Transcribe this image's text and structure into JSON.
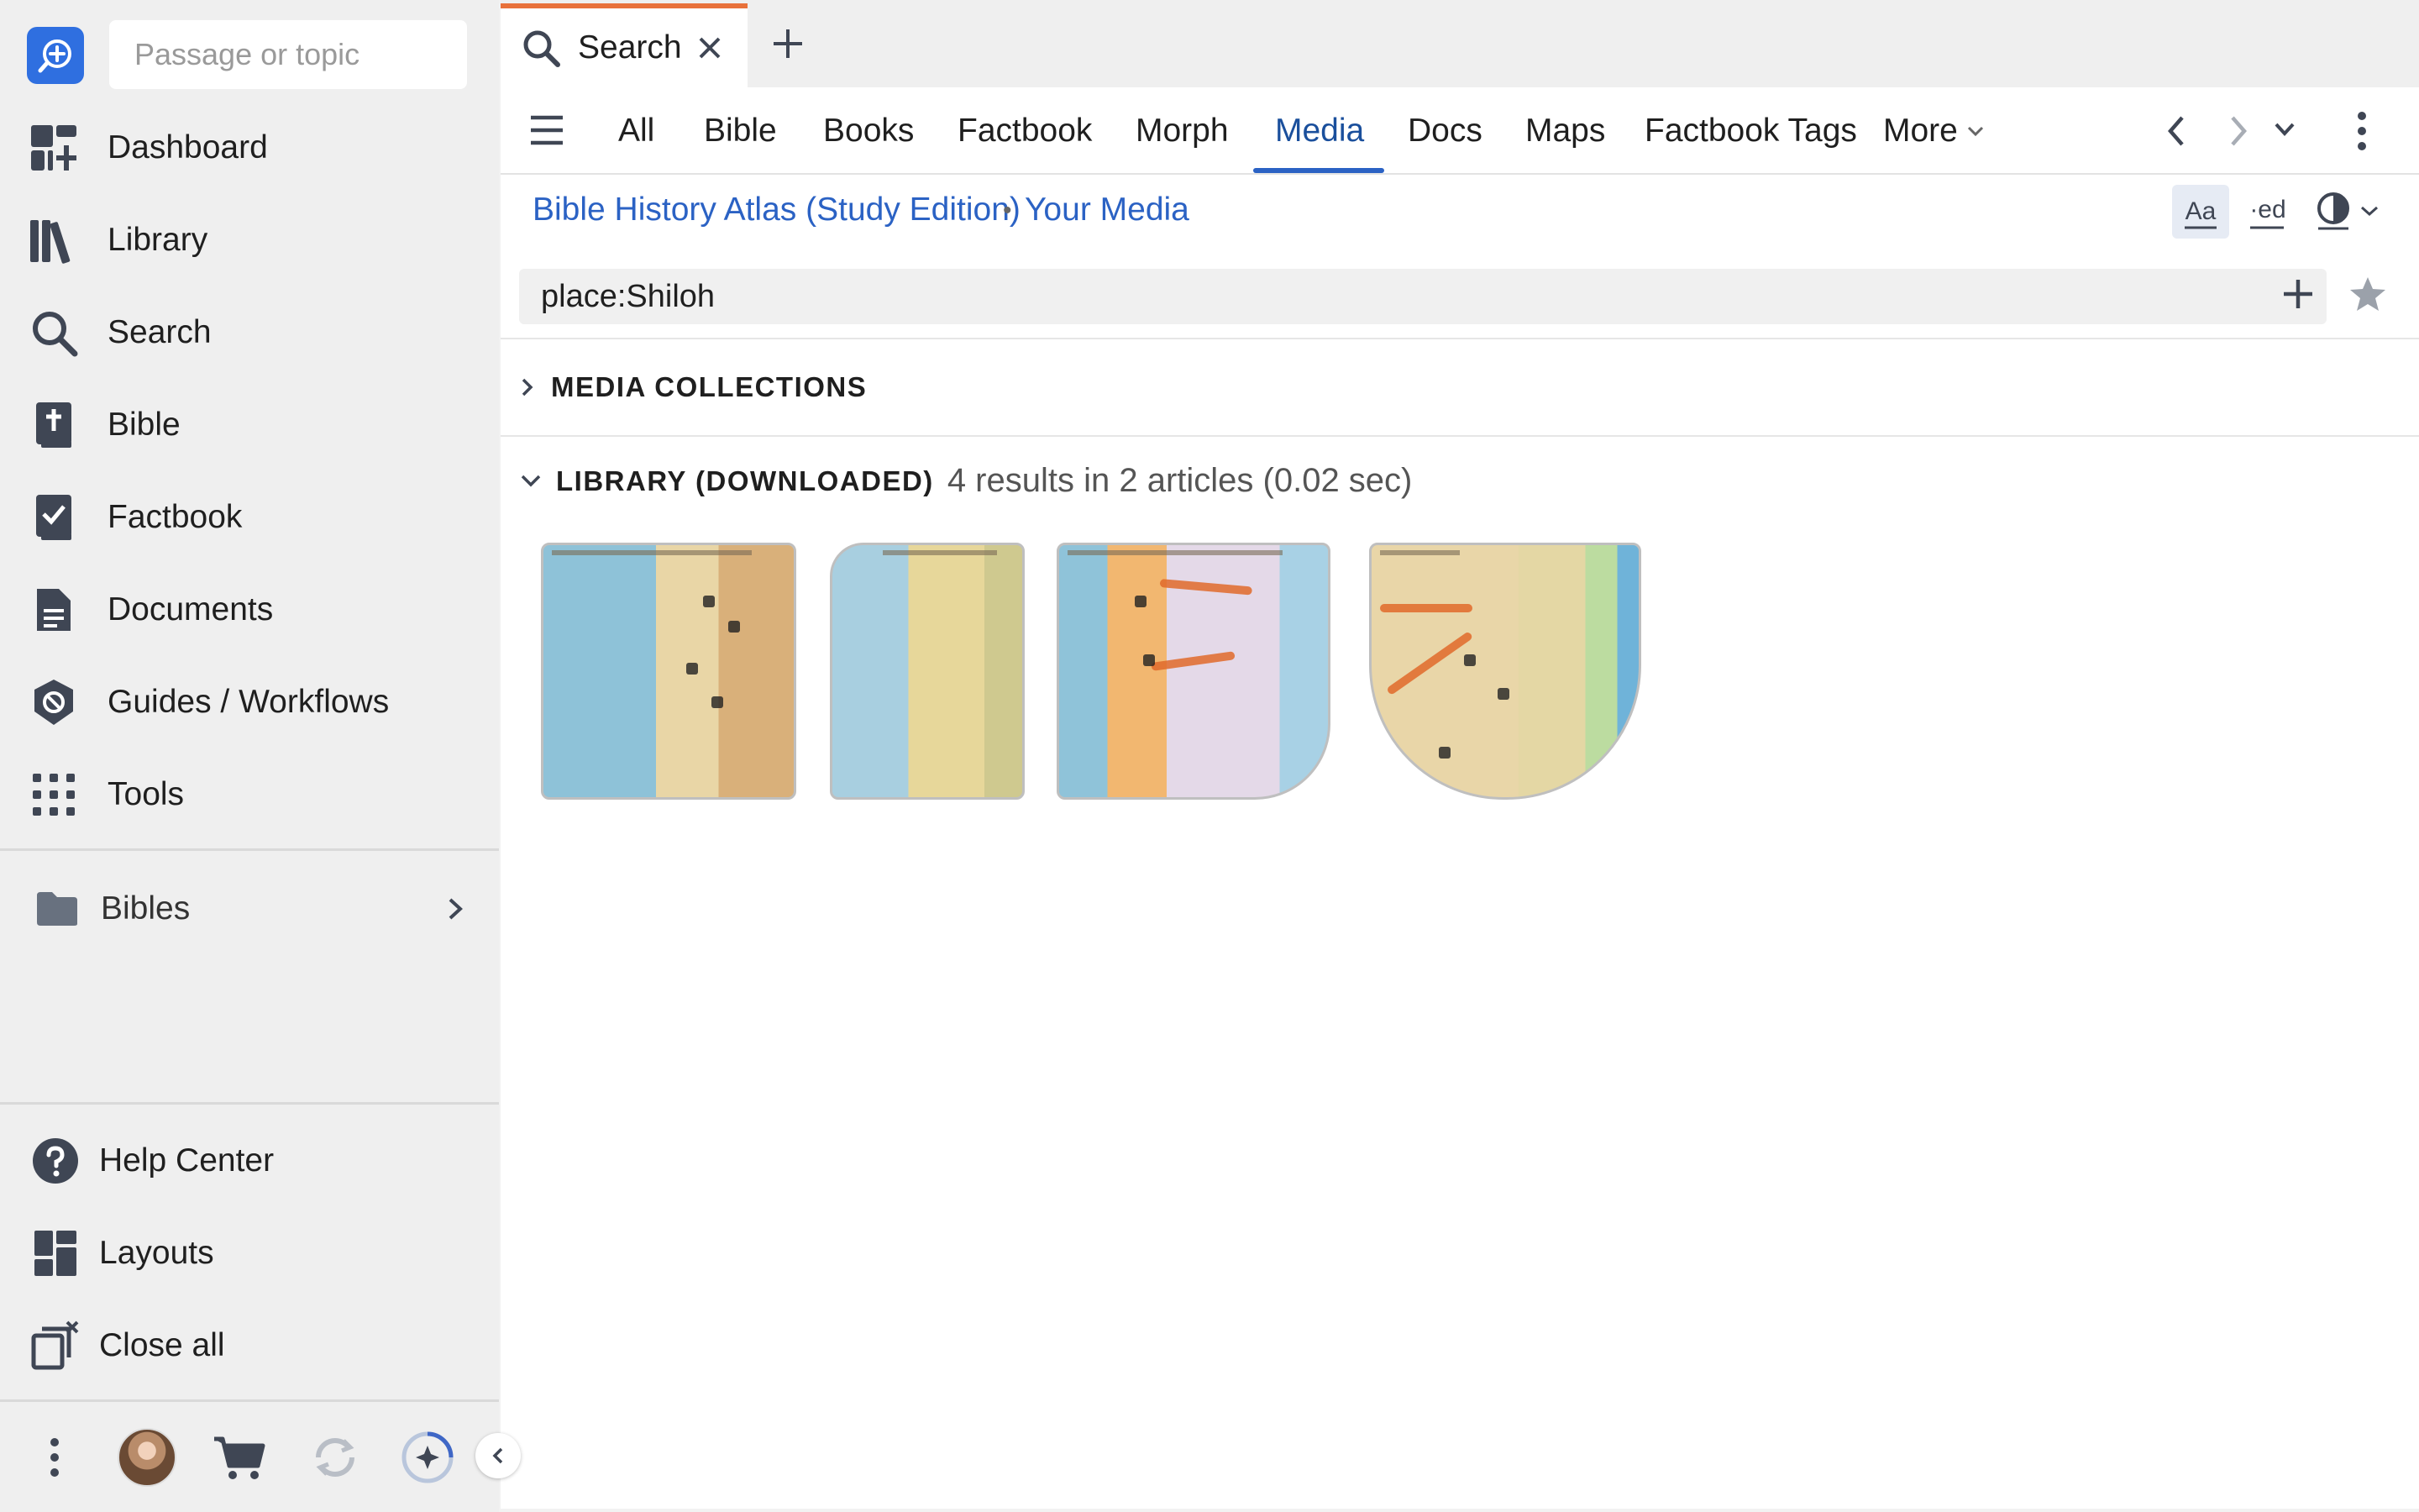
{
  "sidebar": {
    "passage_placeholder": "Passage or topic",
    "nav": [
      {
        "label": "Dashboard",
        "icon": "dashboard-icon"
      },
      {
        "label": "Library",
        "icon": "library-icon"
      },
      {
        "label": "Search",
        "icon": "search-icon"
      },
      {
        "label": "Bible",
        "icon": "bible-icon"
      },
      {
        "label": "Factbook",
        "icon": "factbook-icon"
      },
      {
        "label": "Documents",
        "icon": "documents-icon"
      },
      {
        "label": "Guides / Workflows",
        "icon": "guides-icon"
      },
      {
        "label": "Tools",
        "icon": "tools-icon"
      }
    ],
    "bibles_label": "Bibles",
    "bottom_nav": [
      {
        "label": "Help Center",
        "icon": "help-icon"
      },
      {
        "label": "Layouts",
        "icon": "layouts-icon"
      },
      {
        "label": "Close all",
        "icon": "close-all-icon"
      }
    ]
  },
  "tabs": {
    "active_label": "Search"
  },
  "categories": {
    "items": [
      "All",
      "Bible",
      "Books",
      "Factbook",
      "Morph",
      "Media",
      "Docs",
      "Maps",
      "Factbook Tags",
      "More"
    ],
    "active": "Media"
  },
  "breadcrumb": {
    "resource": "Bible History Atlas (Study Edition)",
    "separator": "•",
    "scope": "Your Media"
  },
  "query": {
    "value": "place:Shiloh"
  },
  "sections": {
    "media_collections": "MEDIA COLLECTIONS",
    "library_title": "LIBRARY (DOWNLOADED)",
    "library_results": "4 results in 2 articles (0.02 sec)"
  },
  "thumbnails": [
    {
      "name": "map-thumbnail-1"
    },
    {
      "name": "map-thumbnail-2"
    },
    {
      "name": "map-thumbnail-3"
    },
    {
      "name": "map-thumbnail-4"
    }
  ],
  "colors": {
    "accent_blue": "#2b62c4",
    "tab_orange": "#e8713a",
    "icon_gray": "#3f4654"
  }
}
